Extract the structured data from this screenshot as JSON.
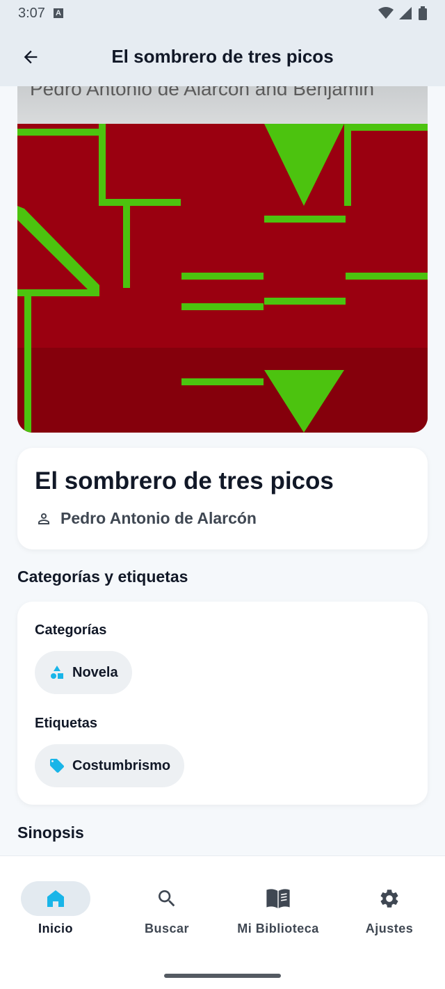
{
  "status_bar": {
    "time": "3:07",
    "notification_letter": "A"
  },
  "app_bar": {
    "title": "El sombrero de tres picos",
    "back_icon": "arrow-back-icon"
  },
  "cover": {
    "top_text": "Pedro Antonio de Alarcón and Benjamin",
    "background_color": "#9a0010",
    "pattern_color": "#4cc30f"
  },
  "book": {
    "title": "El sombrero de tres picos",
    "author": "Pedro Antonio de Alarcón"
  },
  "categories_section": {
    "title": "Categorías y etiquetas",
    "categories_label": "Categorías",
    "categories": [
      {
        "label": "Novela",
        "icon": "shapes-icon"
      }
    ],
    "tags_label": "Etiquetas",
    "tags": [
      {
        "label": "Costumbrismo",
        "icon": "tag-icon"
      }
    ]
  },
  "synopsis": {
    "title": "Sinopsis"
  },
  "bottom_nav": {
    "items": [
      {
        "label": "Inicio",
        "icon": "home-icon",
        "active": true
      },
      {
        "label": "Buscar",
        "icon": "search-icon",
        "active": false
      },
      {
        "label": "Mi Biblioteca",
        "icon": "book-icon",
        "active": false
      },
      {
        "label": "Ajustes",
        "icon": "gear-icon",
        "active": false
      }
    ]
  },
  "colors": {
    "accent": "#19b5e8",
    "app_bar_bg": "#e6ecf2"
  }
}
